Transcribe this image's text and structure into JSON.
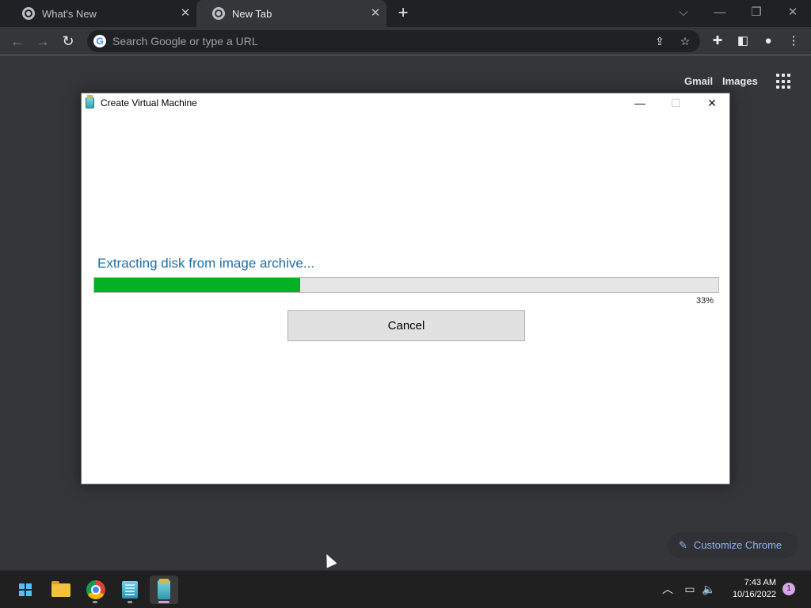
{
  "browser": {
    "tabs": [
      {
        "title": "What's New",
        "active": false
      },
      {
        "title": "New Tab",
        "active": true
      }
    ],
    "new_tab_symbol": "+",
    "omnibox": {
      "placeholder": "Search Google or type a URL",
      "value": ""
    },
    "window_controls": [
      "chevron-down-icon",
      "minimize-icon",
      "restore-icon",
      "close-icon"
    ]
  },
  "ntp": {
    "gmail_label": "Gmail",
    "images_label": "Images",
    "customize_label": "Customize Chrome"
  },
  "dialog": {
    "title": "Create Virtual Machine",
    "status_message": "Extracting disk from image archive...",
    "progress_percent": 33,
    "progress_label": "33%",
    "cancel_label": "Cancel",
    "progress_color": "#06b025",
    "status_color": "#1e6fa8"
  },
  "taskbar": {
    "apps": [
      "windows-start-icon",
      "file-explorer-icon",
      "chrome-icon",
      "building-app-icon",
      "virtual-machine-icon"
    ],
    "active_app": "virtual-machine-icon",
    "time": "7:43 AM",
    "date": "10/16/2022",
    "notification_count": "1"
  }
}
